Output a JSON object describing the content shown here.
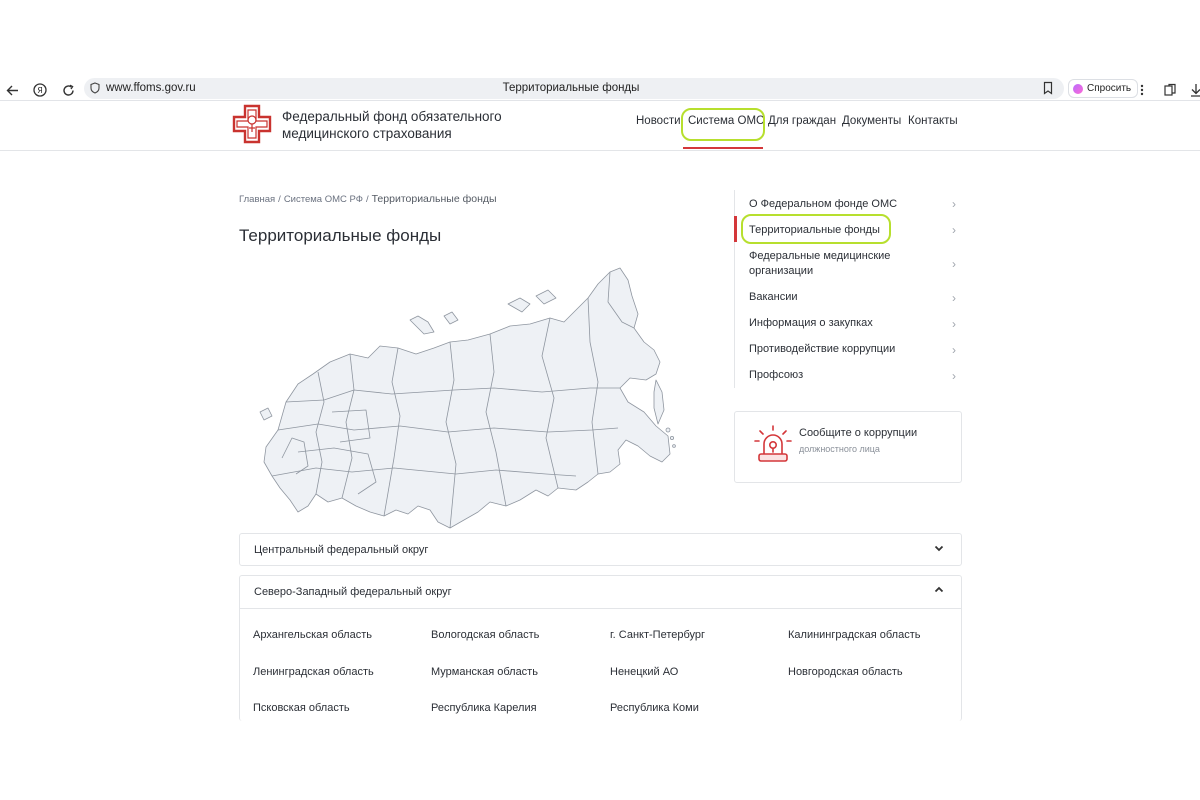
{
  "browser": {
    "url": "www.ffoms.gov.ru",
    "tab_title": "Территориальные фонды",
    "ask_label": "Спросить"
  },
  "header": {
    "org_name_line1": "Федеральный фонд обязательного",
    "org_name_line2": "медицинского страхования",
    "nav": [
      {
        "label": "Новости",
        "active": false
      },
      {
        "label": "Система ОМС",
        "active": true
      },
      {
        "label": "Для граждан",
        "active": false
      },
      {
        "label": "Документы",
        "active": false
      },
      {
        "label": "Контакты",
        "active": false
      }
    ]
  },
  "breadcrumb": {
    "items": [
      "Главная",
      "Система ОМС РФ"
    ],
    "separator": "/",
    "current": "Территориальные фонды"
  },
  "page": {
    "title": "Территориальные фонды"
  },
  "sidebar": {
    "items": [
      {
        "line1": "О Федеральном фонде ОМС",
        "line2": "",
        "active": false
      },
      {
        "line1": "Территориальные фонды",
        "line2": "",
        "active": true
      },
      {
        "line1": "Федеральные медицинские",
        "line2": "организации",
        "active": false
      },
      {
        "line1": "Вакансии",
        "line2": "",
        "active": false
      },
      {
        "line1": "Информация о закупках",
        "line2": "",
        "active": false
      },
      {
        "line1": "Противодействие коррупции",
        "line2": "",
        "active": false
      },
      {
        "line1": "Профсоюз",
        "line2": "",
        "active": false
      }
    ],
    "corruption": {
      "title": "Сообщите о коррупции",
      "subtitle": "должностного лица"
    }
  },
  "districts": [
    {
      "name": "Центральный федеральный округ",
      "expanded": false,
      "regions": []
    },
    {
      "name": "Северо-Западный федеральный округ",
      "expanded": true,
      "regions": [
        "Архангельская область",
        "Вологодская область",
        "г. Санкт-Петербург",
        "Калининградская область",
        "Ленинградская область",
        "Мурманская область",
        "Ненецкий АО",
        "Новгородская область",
        "Псковская область",
        "Республика Карелия",
        "Республика Коми"
      ]
    }
  ],
  "colors": {
    "accent_red": "#d4373a",
    "highlight_ring": "#b7df2e",
    "map_fill": "#eef1f5",
    "map_stroke": "#8f96a0"
  },
  "icons": [
    "back-icon",
    "yandex-icon",
    "reload-icon",
    "shield-icon",
    "bookmark-icon",
    "menu-dots-icon",
    "extension-icon",
    "download-icon",
    "logo-cross-icon",
    "siren-icon",
    "chevron-right-icon",
    "chevron-down-icon",
    "chevron-up-icon"
  ]
}
